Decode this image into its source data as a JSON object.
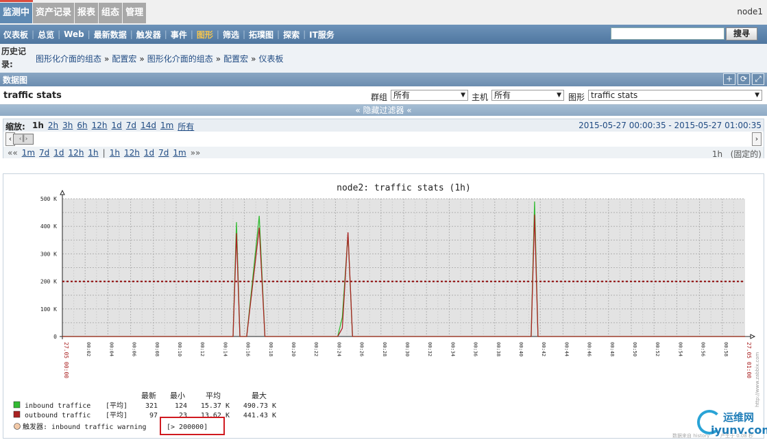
{
  "topnav": {
    "tabs": [
      "监测中",
      "资产记录",
      "报表",
      "组态",
      "管理"
    ],
    "active": 0,
    "user_node": "node1"
  },
  "subnav": {
    "items": [
      "仪表板",
      "总览",
      "Web",
      "最新数据",
      "触发器",
      "事件",
      "图形",
      "筛选",
      "拓璞图",
      "探索",
      "IT服务"
    ],
    "active": 6,
    "search_value": "",
    "search_button": "搜寻"
  },
  "history": {
    "label": "历史记录:",
    "crumbs": [
      "图形化介面的组态",
      "配置宏",
      "图形化介面的组态",
      "配置宏",
      "仪表板"
    ]
  },
  "section": {
    "title": "数据图"
  },
  "filter": {
    "graph_title": "traffic stats",
    "group_label": "群组",
    "group_value": "所有",
    "host_label": "主机",
    "host_value": "所有",
    "graph_label": "图形",
    "graph_value": "traffic stats",
    "hide_filter": "« 隐藏过滤器 «"
  },
  "zoom": {
    "label": "缩放:",
    "options": [
      "1h",
      "2h",
      "3h",
      "6h",
      "12h",
      "1d",
      "7d",
      "14d",
      "1m",
      "所有"
    ],
    "current": 0,
    "range_text": "2015-05-27 00:00:35  -  2015-05-27 01:00:35",
    "nav_back": [
      "««",
      "1m",
      "7d",
      "1d",
      "12h",
      "1h"
    ],
    "nav_sep": "|",
    "nav_forward": [
      "1h",
      "12h",
      "1d",
      "7d",
      "1m",
      "»»"
    ],
    "period": "1h",
    "fixed": "(固定的)"
  },
  "chart_data": {
    "type": "line",
    "title": "node2: traffic stats (1h)",
    "y_ticks": [
      "0",
      "100 K",
      "200 K",
      "300 K",
      "400 K",
      "500 K"
    ],
    "ylim": [
      0,
      500000
    ],
    "x_start_label": "27.05 00:00",
    "x_end_label": "27.05 01:00",
    "x_ticks": [
      "00:02",
      "00:04",
      "00:06",
      "00:08",
      "00:10",
      "00:12",
      "00:14",
      "00:16",
      "00:18",
      "00:20",
      "00:22",
      "00:24",
      "00:26",
      "00:28",
      "00:30",
      "00:32",
      "00:34",
      "00:36",
      "00:38",
      "00:40",
      "00:42",
      "00:44",
      "00:46",
      "00:48",
      "00:50",
      "00:52",
      "00:54",
      "00:56",
      "00:58"
    ],
    "grid": true,
    "colors": {
      "inbound": "#33bb33",
      "outbound": "#aa2222",
      "trigger": "#8b0000",
      "plot_bg": "#e3e3e3"
    },
    "series": [
      {
        "name": "inbound traffice",
        "points": [
          [
            0,
            0
          ],
          [
            15,
            0
          ],
          [
            15.3,
            415000
          ],
          [
            15.6,
            0
          ],
          [
            16.2,
            0
          ],
          [
            17.3,
            438000
          ],
          [
            17.8,
            0
          ],
          [
            24.2,
            0
          ],
          [
            24.6,
            70000
          ],
          [
            25.1,
            372000
          ],
          [
            25.5,
            0
          ],
          [
            41.2,
            0
          ],
          [
            41.5,
            490000
          ],
          [
            41.8,
            0
          ],
          [
            60,
            0
          ]
        ]
      },
      {
        "name": "outbound traffic",
        "points": [
          [
            0,
            0
          ],
          [
            15,
            0
          ],
          [
            15.3,
            375000
          ],
          [
            15.6,
            0
          ],
          [
            16.2,
            0
          ],
          [
            17.3,
            395000
          ],
          [
            17.8,
            0
          ],
          [
            24.2,
            0
          ],
          [
            24.6,
            30000
          ],
          [
            25.1,
            378000
          ],
          [
            25.5,
            0
          ],
          [
            41.2,
            0
          ],
          [
            41.5,
            442000
          ],
          [
            41.8,
            0
          ],
          [
            60,
            0
          ]
        ]
      }
    ],
    "trigger_level": 200000,
    "legend": {
      "headers": [
        "最新",
        "最小",
        "平均",
        "最大"
      ],
      "rows": [
        {
          "name": "inbound traffice",
          "agg": "[平均]",
          "last": "321",
          "min": "124",
          "avg": "15.37 K",
          "max": "490.73 K"
        },
        {
          "name": "outbound traffic",
          "agg": "[平均]",
          "last": "97",
          "min": "23",
          "avg": "13.62 K",
          "max": "441.43 K"
        }
      ],
      "trigger_text": "触发器: inbound traffic warning",
      "trigger_value": "[> 200000]"
    },
    "side_credit": "http://www.zabbix.com",
    "footer_left": "数据来自 history",
    "footer_right": "产生于 0.08 秒"
  },
  "logo": {
    "line1": "运维网",
    "line2": "iyunv.com"
  }
}
